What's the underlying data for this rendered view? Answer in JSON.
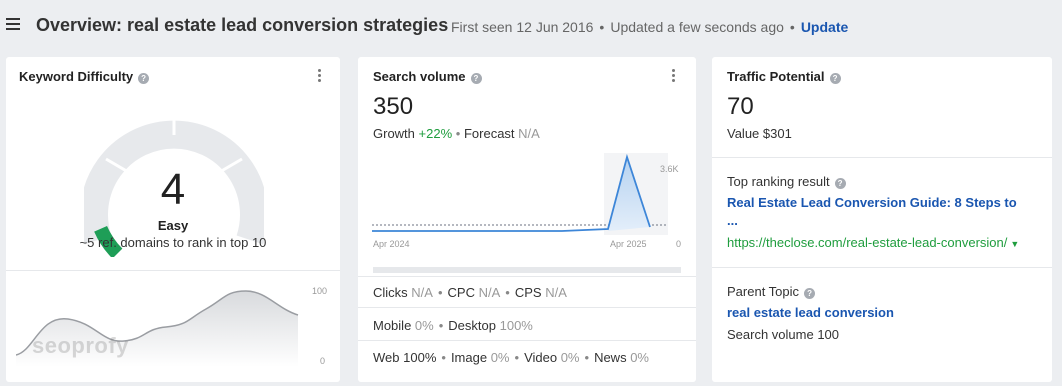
{
  "header": {
    "title": "Overview: real estate lead conversion strategies",
    "first_seen": "First seen 12 Jun 2016",
    "updated": "Updated a few seconds ago",
    "update_link": "Update",
    "separator": "•"
  },
  "keyword_difficulty": {
    "title": "Keyword Difficulty",
    "value": "4",
    "label": "Easy",
    "description": "~5 ref. domains to rank in top 10",
    "gauge_fill_fraction": 0.04,
    "gauge_color": "#1e9e57",
    "chart_axis_max": "100",
    "chart_axis_min": "0",
    "watermark": "seoprofy"
  },
  "search_volume": {
    "title": "Search volume",
    "value": "350",
    "growth_label": "Growth",
    "growth_value": "+22%",
    "forecast_label": "Forecast",
    "forecast_value": "N/A",
    "chart_y_max": "3.6K",
    "chart_y_min": "0",
    "chart_x_start": "Apr 2024",
    "chart_x_end": "Apr 2025",
    "clicks_label": "Clicks",
    "clicks_value": "N/A",
    "cpc_label": "CPC",
    "cpc_value": "N/A",
    "cps_label": "CPS",
    "cps_value": "N/A",
    "mobile_label": "Mobile",
    "mobile_value": "0%",
    "desktop_label": "Desktop",
    "desktop_value": "100%",
    "web_label": "Web",
    "web_value": "100%",
    "image_label": "Image",
    "image_value": "0%",
    "video_label": "Video",
    "video_value": "0%",
    "news_label": "News",
    "news_value": "0%"
  },
  "traffic_potential": {
    "title": "Traffic Potential",
    "value": "70",
    "value_label": "Value $301",
    "top_ranking_label": "Top ranking result",
    "top_ranking_title": "Real Estate Lead Conversion Guide: 8 Steps to",
    "top_ranking_title_cont": "...",
    "top_ranking_url": "https://theclose.com/real-estate-lead-conversion/",
    "parent_topic_label": "Parent Topic",
    "parent_topic": "real estate lead conversion",
    "parent_search_volume": "Search volume 100"
  },
  "colors": {
    "accent_link": "#1a56b0",
    "positive": "#1f9d3e",
    "chart_line": "#3d86d8",
    "kd_green": "#1e9e57"
  }
}
